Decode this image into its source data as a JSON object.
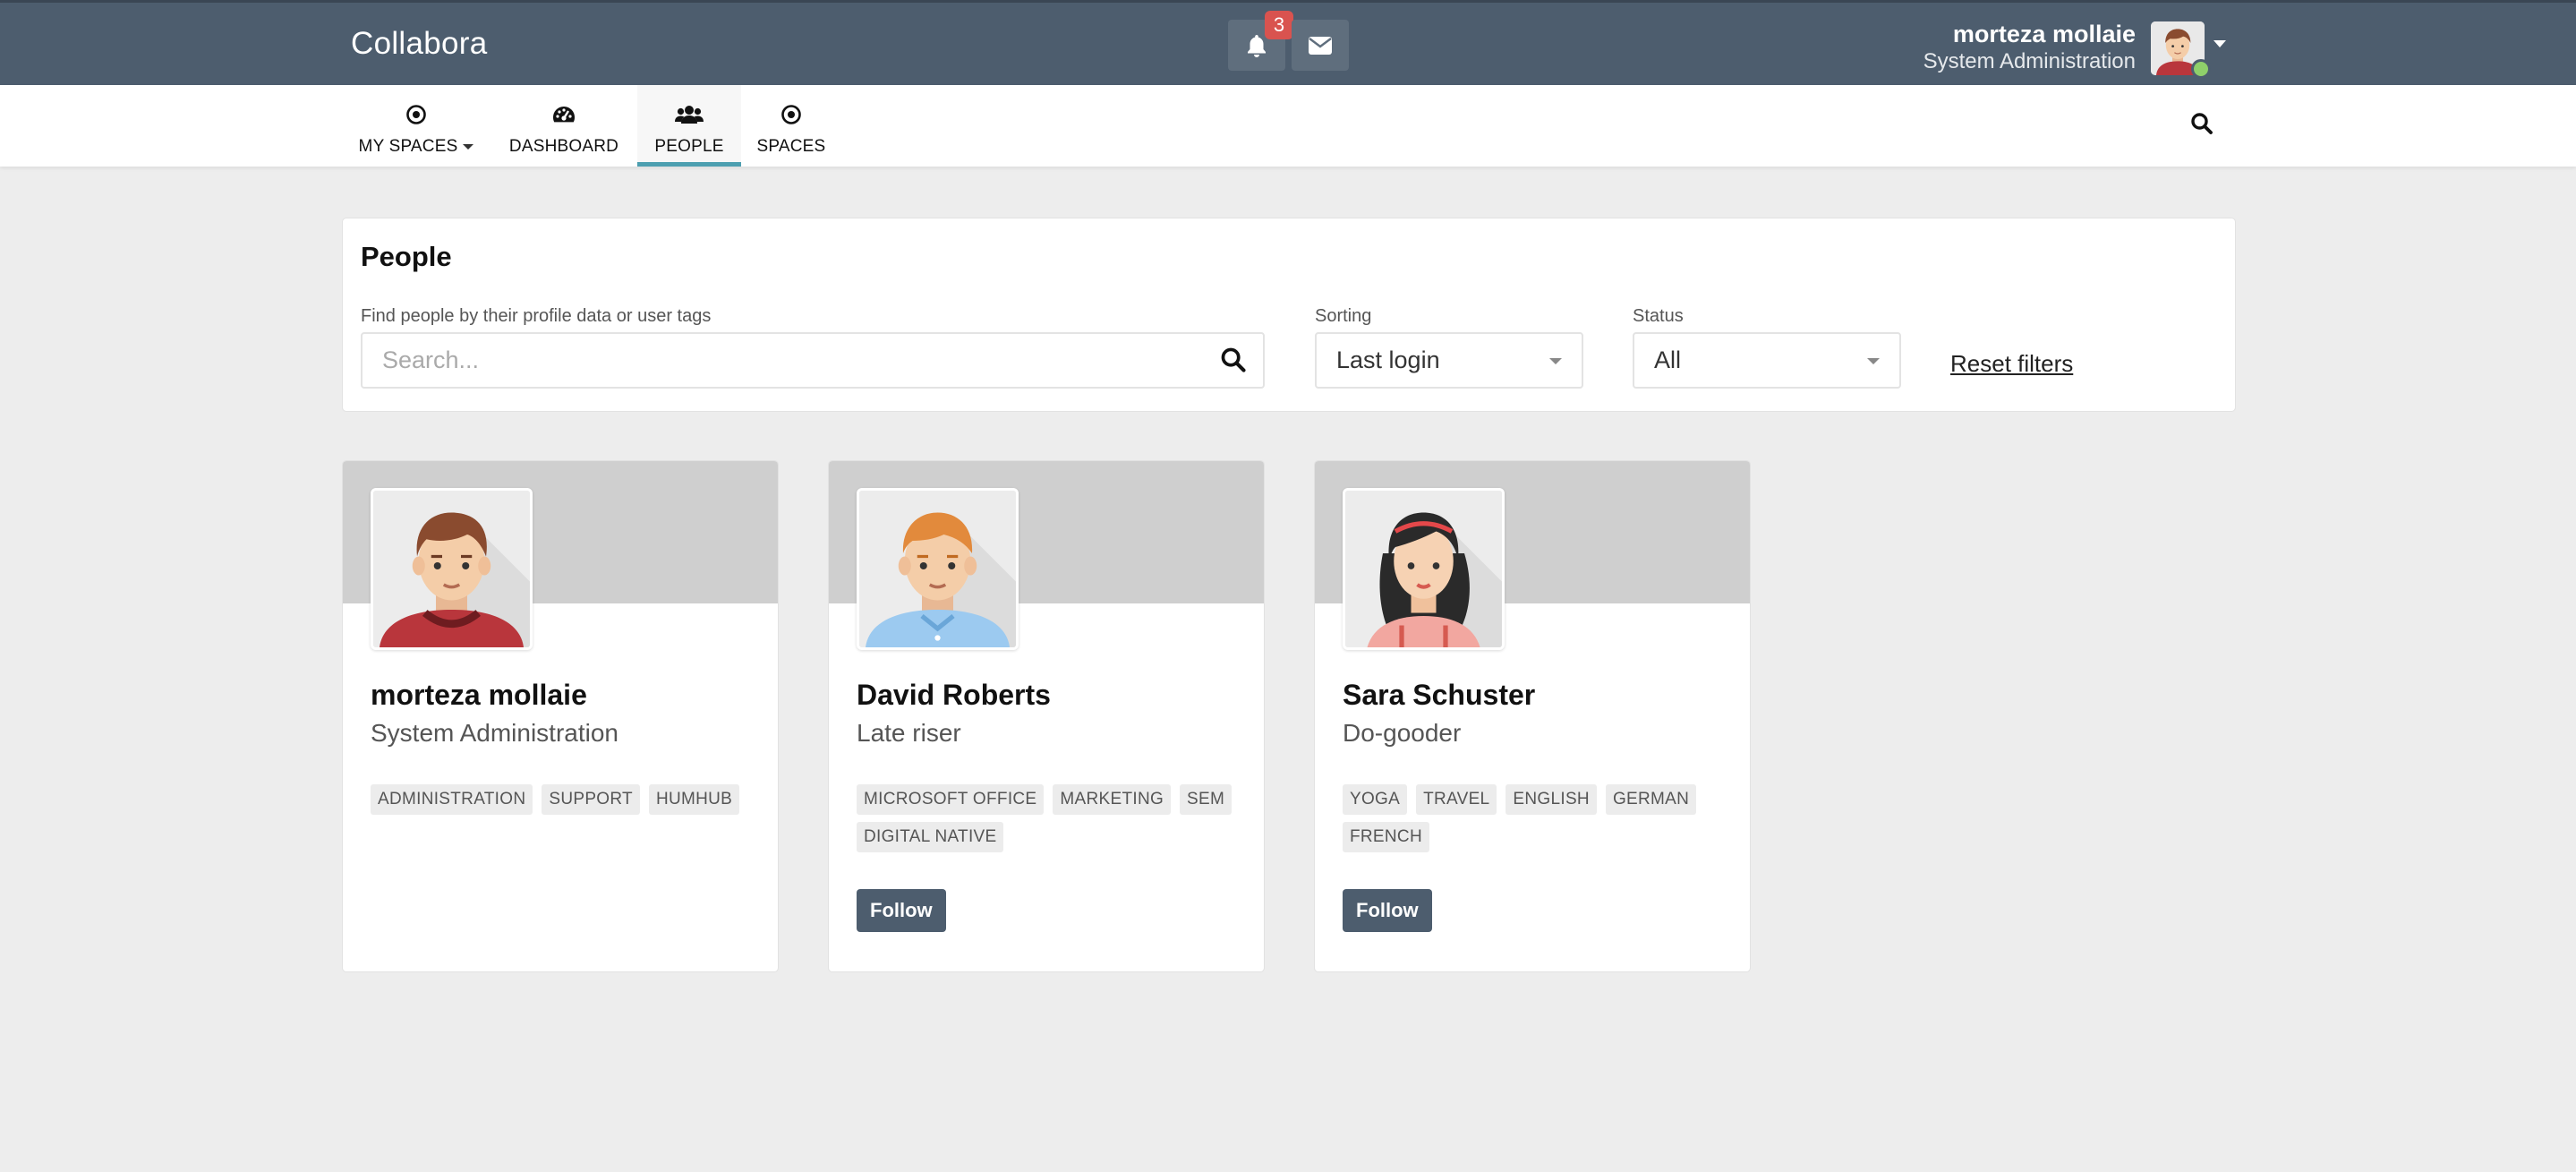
{
  "header": {
    "brand": "Collabora",
    "notification_count": "3",
    "user_name": "morteza mollaie",
    "user_title": "System Administration"
  },
  "nav": {
    "items": [
      {
        "label": "MY SPACES",
        "icon": "dot-circle-icon"
      },
      {
        "label": "DASHBOARD",
        "icon": "dashboard-icon"
      },
      {
        "label": "PEOPLE",
        "icon": "users-icon"
      },
      {
        "label": "SPACES",
        "icon": "dot-circle-icon"
      }
    ],
    "active": "PEOPLE"
  },
  "filters": {
    "title": "People",
    "search_label": "Find people by their profile data or user tags",
    "search_placeholder": "Search...",
    "sorting_label": "Sorting",
    "sorting_value": "Last login",
    "status_label": "Status",
    "status_value": "All",
    "reset_label": "Reset filters"
  },
  "people": [
    {
      "name": "morteza mollaie",
      "title": "System Administration",
      "tags": [
        "ADMINISTRATION",
        "SUPPORT",
        "HUMHUB"
      ],
      "follow_label": ""
    },
    {
      "name": "David Roberts",
      "title": "Late riser",
      "tags": [
        "MICROSOFT OFFICE",
        "MARKETING",
        "SEM",
        "DIGITAL NATIVE"
      ],
      "follow_label": "Follow"
    },
    {
      "name": "Sara Schuster",
      "title": "Do-gooder",
      "tags": [
        "YOGA",
        "TRAVEL",
        "ENGLISH",
        "GERMAN",
        "FRENCH"
      ],
      "follow_label": "Follow"
    }
  ],
  "colors": {
    "topbar": "#4d5d6e",
    "accent": "#4d9fb0",
    "badge": "#d9534f",
    "online": "#8fcf6a"
  }
}
